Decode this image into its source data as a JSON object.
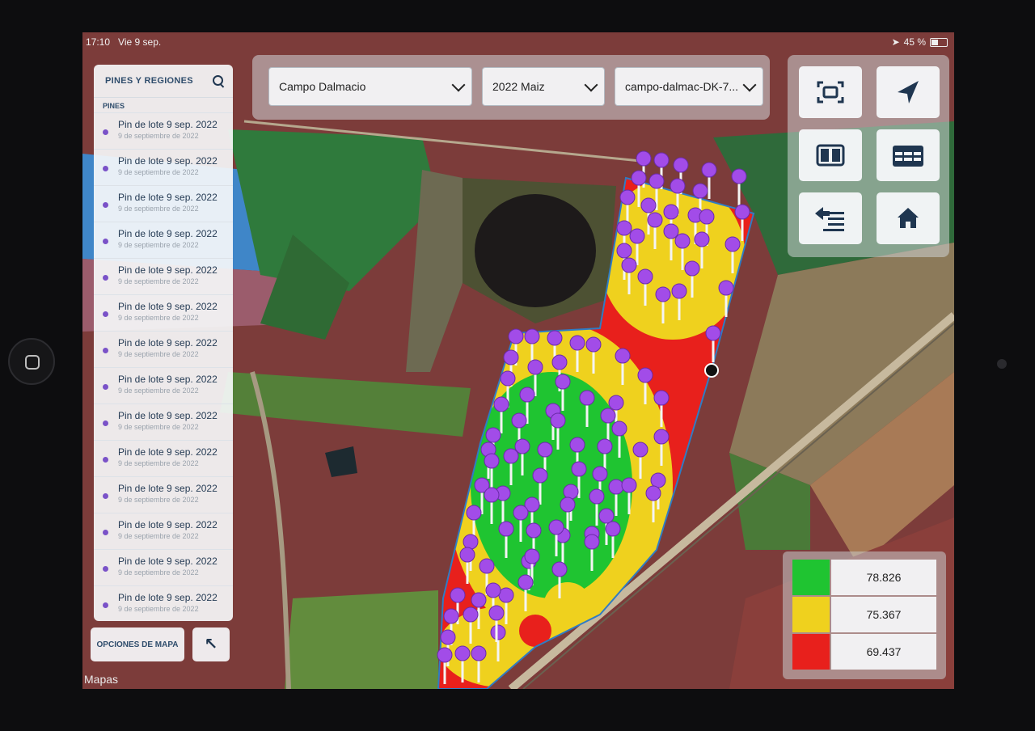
{
  "status_bar": {
    "time": "17:10",
    "date": "Vie 9 sep.",
    "battery": "45 %"
  },
  "panel": {
    "title": "PINES Y REGIONES",
    "section": "PINES",
    "items": [
      {
        "title": "Pin de lote 9 sep. 2022",
        "subtitle": "9 de septiembre de 2022"
      },
      {
        "title": "Pin de lote 9 sep. 2022",
        "subtitle": "9 de septiembre de 2022"
      },
      {
        "title": "Pin de lote 9 sep. 2022",
        "subtitle": "9 de septiembre de 2022"
      },
      {
        "title": "Pin de lote 9 sep. 2022",
        "subtitle": "9 de septiembre de 2022"
      },
      {
        "title": "Pin de lote 9 sep. 2022",
        "subtitle": "9 de septiembre de 2022"
      },
      {
        "title": "Pin de lote 9 sep. 2022",
        "subtitle": "9 de septiembre de 2022"
      },
      {
        "title": "Pin de lote 9 sep. 2022",
        "subtitle": "9 de septiembre de 2022"
      },
      {
        "title": "Pin de lote 9 sep. 2022",
        "subtitle": "9 de septiembre de 2022"
      },
      {
        "title": "Pin de lote 9 sep. 2022",
        "subtitle": "9 de septiembre de 2022"
      },
      {
        "title": "Pin de lote 9 sep. 2022",
        "subtitle": "9 de septiembre de 2022"
      },
      {
        "title": "Pin de lote 9 sep. 2022",
        "subtitle": "9 de septiembre de 2022"
      },
      {
        "title": "Pin de lote 9 sep. 2022",
        "subtitle": "9 de septiembre de 2022"
      },
      {
        "title": "Pin de lote 9 sep. 2022",
        "subtitle": "9 de septiembre de 2022"
      },
      {
        "title": "Pin de lote 9 sep. 2022",
        "subtitle": "9 de septiembre de 2022"
      }
    ],
    "map_options_label": "OPCIONES DE MAPA",
    "expand_icon": "arrow-up-left-icon"
  },
  "selectors": {
    "field": "Campo Dalmacio",
    "season": "2022 Maiz",
    "map": "campo-dalmac-DK-7..."
  },
  "tools": [
    "fit-to-screen-icon",
    "location-arrow-icon",
    "split-view-icon",
    "table-icon",
    "import-list-icon",
    "home-icon"
  ],
  "legend": [
    {
      "color": "#1fc431",
      "value": "78.826"
    },
    {
      "color": "#efd11e",
      "value": "75.367"
    },
    {
      "color": "#e8201c",
      "value": "69.437"
    }
  ],
  "maps_logo": "Mapas",
  "colors": {
    "pin": "#a24ce8",
    "accent": "#2f4d6c"
  }
}
